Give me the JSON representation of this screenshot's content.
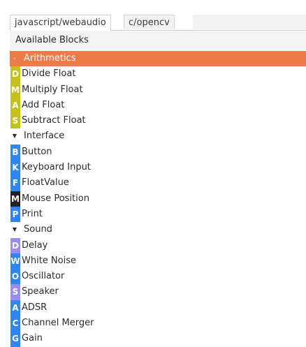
{
  "tabs": [
    {
      "label": "javascript/webaudio",
      "active": true
    },
    {
      "label": "c/opencv",
      "active": false
    }
  ],
  "header": {
    "title": "Available Blocks"
  },
  "colors": {
    "selected": "#ee7a4a",
    "olive": "#c4c11a",
    "blue": "#2f86ef",
    "black": "#222222",
    "lavender": "#9b8df0"
  },
  "categories": [
    {
      "name": "Arithmetics",
      "expanded": true,
      "selected": true,
      "toggle": "-",
      "items": [
        {
          "letter": "D",
          "label": "Divide Float",
          "color": "olive"
        },
        {
          "letter": "M",
          "label": "Multiply Float",
          "color": "olive"
        },
        {
          "letter": "A",
          "label": "Add Float",
          "color": "olive"
        },
        {
          "letter": "S",
          "label": "Subtract Float",
          "color": "olive"
        }
      ]
    },
    {
      "name": "Interface",
      "expanded": true,
      "selected": false,
      "toggle": "▼",
      "items": [
        {
          "letter": "B",
          "label": "Button",
          "color": "blue"
        },
        {
          "letter": "K",
          "label": "Keyboard Input",
          "color": "blue"
        },
        {
          "letter": "F",
          "label": "FloatValue",
          "color": "blue"
        },
        {
          "letter": "M",
          "label": "Mouse Position",
          "color": "black"
        },
        {
          "letter": "P",
          "label": "Print",
          "color": "blue"
        }
      ]
    },
    {
      "name": "Sound",
      "expanded": true,
      "selected": false,
      "toggle": "▼",
      "items": [
        {
          "letter": "D",
          "label": "Delay",
          "color": "lavender"
        },
        {
          "letter": "W",
          "label": "White Noise",
          "color": "blue"
        },
        {
          "letter": "O",
          "label": "Oscillator",
          "color": "blue"
        },
        {
          "letter": "S",
          "label": "Speaker",
          "color": "lavender"
        },
        {
          "letter": "A",
          "label": "ADSR",
          "color": "blue"
        },
        {
          "letter": "C",
          "label": "Channel Merger",
          "color": "blue"
        },
        {
          "letter": "G",
          "label": "Gain",
          "color": "blue"
        }
      ]
    }
  ]
}
